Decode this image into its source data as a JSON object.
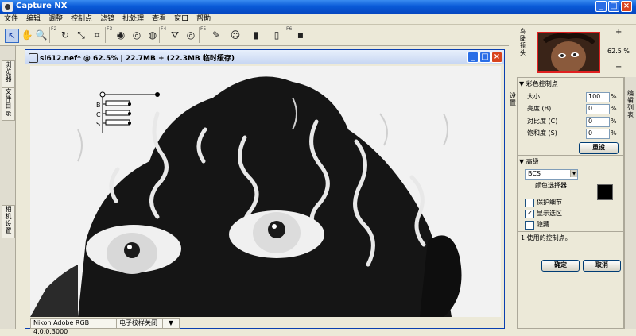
{
  "app": {
    "title": "Capture NX"
  },
  "window_controls": {
    "minimize": "_",
    "maximize": "□",
    "close": "×"
  },
  "menu": [
    "文件",
    "编辑",
    "调整",
    "控制点",
    "滤镜",
    "批处理",
    "查看",
    "窗口",
    "帮助"
  ],
  "toolbar": {
    "tools": [
      "↖",
      "✋",
      "🔍",
      "↻",
      "⤡",
      "⌗",
      "◉",
      "◎",
      "◍",
      "⛛",
      "◎",
      "✎",
      "☺",
      "▮",
      "▯",
      "▪"
    ],
    "group_labels": [
      "F2",
      "F3",
      "F4",
      "F5",
      "F6"
    ]
  },
  "left_panel": {
    "tabs": [
      "浏览器",
      "文件目录",
      "相机设置"
    ]
  },
  "document": {
    "title": "sl612.nef* @ 62.5% | 22.7MB + (22.3MB 临时缓存)",
    "control_point_labels": [
      "B",
      "C",
      "S"
    ],
    "status": {
      "profile": "Nikon Adobe RGB 4.0.0.3000",
      "softproof": "电子校样关闭",
      "dropdown": "▼"
    }
  },
  "birdseye": {
    "label": "鸟瞰镜头",
    "zoom": "62.5 %",
    "zoom_in": "+",
    "zoom_out": "−"
  },
  "color_control_point": {
    "header": "彩色控制点",
    "fields": [
      {
        "label": "大小",
        "value": "100",
        "unit": "%"
      },
      {
        "label": "亮度 (B)",
        "value": "0",
        "unit": "%"
      },
      {
        "label": "对比度 (C)",
        "value": "0",
        "unit": "%"
      },
      {
        "label": "饱和度 (S)",
        "value": "0",
        "unit": "%"
      }
    ],
    "reset_button": "重设"
  },
  "advanced": {
    "header": "高级",
    "mode_select": "BCS",
    "color_picker_label": "颜色选择器",
    "swatch_color": "#000000",
    "checkboxes": [
      {
        "label": "保护细节",
        "checked": false
      },
      {
        "label": "显示选区",
        "checked": true
      },
      {
        "label": "隐藏",
        "checked": false
      }
    ],
    "status": "1 使用的控制点。"
  },
  "buttons": {
    "ok": "确定",
    "cancel": "取消"
  },
  "side_labels": {
    "settings": "设置",
    "edit_list": "编辑列表"
  }
}
